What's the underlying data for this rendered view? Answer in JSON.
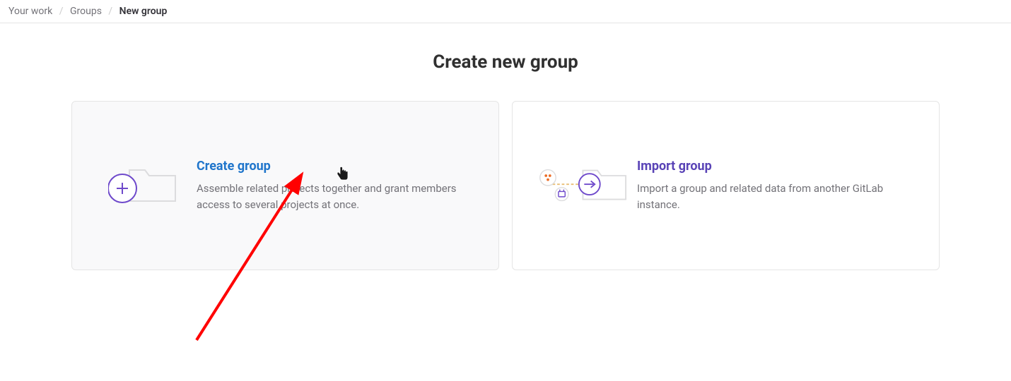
{
  "breadcrumbs": {
    "items": [
      {
        "label": "Your work"
      },
      {
        "label": "Groups"
      }
    ],
    "current": "New group"
  },
  "page": {
    "title": "Create new group"
  },
  "cards": {
    "create": {
      "title": "Create group",
      "description": "Assemble related projects together and grant members access to several projects at once."
    },
    "import": {
      "title": "Import group",
      "description": "Import a group and related data from another GitLab instance."
    }
  }
}
